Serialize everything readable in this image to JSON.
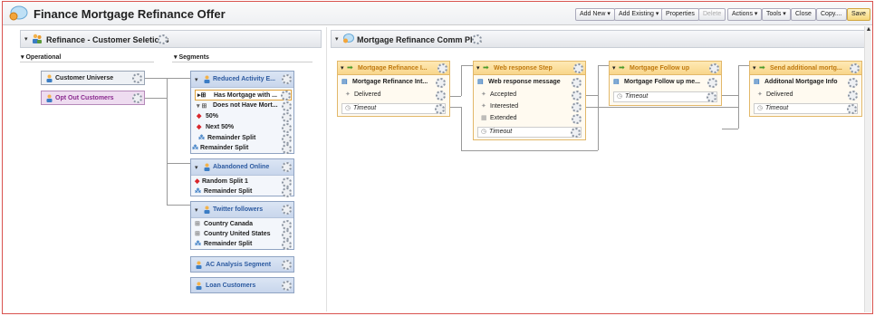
{
  "app": {
    "title": "Finance Mortgage Refinance Offer"
  },
  "toolbar": {
    "add_new": "Add New ▾",
    "add_existing": "Add Existing ▾",
    "properties": "Properties",
    "delete": "Delete",
    "actions": "Actions ▾",
    "tools": "Tools ▾",
    "close": "Close",
    "copy": "Copy....",
    "save": "Save"
  },
  "left_panel": {
    "title": "Refinance - Customer Seletions",
    "operational_label": "Operational",
    "segments_label": "Segments",
    "operational_nodes": [
      "Customer Universe",
      "Opt Out Customers"
    ],
    "segment_groups": [
      {
        "title": "Reduced Activity E...",
        "rows": [
          "Has Mortgage with ...",
          "Does not Have Mort...",
          "50%",
          "Next 50%",
          "Remainder Split",
          "Remainder Split"
        ]
      },
      {
        "title": "Abandoned Online",
        "rows": [
          "Random Split 1",
          "Remainder Split"
        ]
      },
      {
        "title": "Twitter followers",
        "rows": [
          "Country Canada",
          "Country United States",
          "Remainder Split"
        ]
      }
    ],
    "segment_singles": [
      "AC Analysis Segment",
      "Loan Customers"
    ]
  },
  "right_panel": {
    "title": "Mortgage Refinance Comm Plan",
    "flows": [
      {
        "title": "Mortgage Refinance I...",
        "message": "Mortgage Refinance Int...",
        "rows": [
          "Delivered"
        ],
        "timeout": "Timeout"
      },
      {
        "title": "Web response Step",
        "message": "Web response message",
        "rows": [
          "Accepted",
          "Interested",
          "Extended"
        ],
        "timeout": "Timeout"
      },
      {
        "title": "Mortgage Follow up",
        "message": "Mortgage Follow up me...",
        "rows": [],
        "timeout": "Timeout"
      },
      {
        "title": "Send additional mortg...",
        "message": "Additonal Mortgage Info",
        "rows": [
          "Delivered"
        ],
        "timeout": "Timeout"
      }
    ]
  }
}
